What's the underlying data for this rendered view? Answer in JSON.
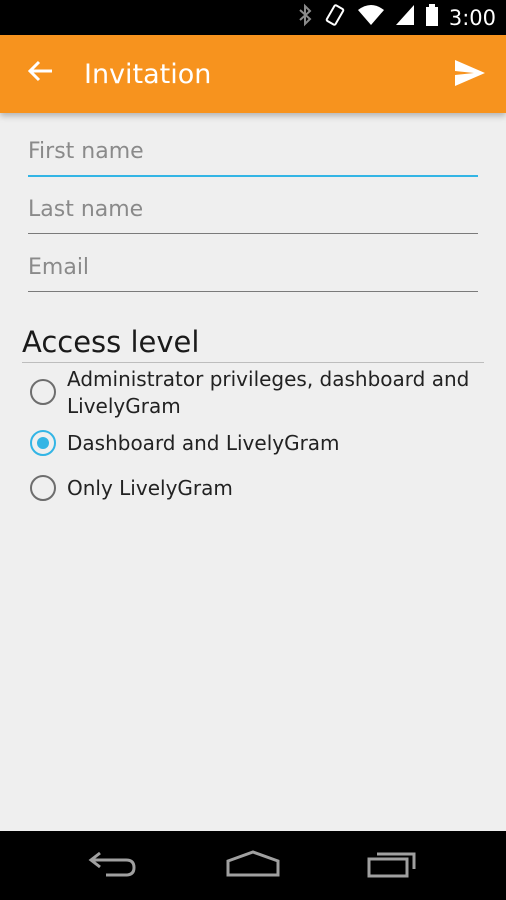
{
  "status_bar": {
    "time": "3:00"
  },
  "app_bar": {
    "title": "Invitation"
  },
  "form": {
    "first_name": {
      "placeholder": "First name",
      "value": ""
    },
    "last_name": {
      "placeholder": "Last name",
      "value": ""
    },
    "email": {
      "placeholder": "Email",
      "value": ""
    }
  },
  "access": {
    "title": "Access level",
    "options": [
      {
        "label": "Administrator privileges, dashboard and LivelyGram",
        "checked": false
      },
      {
        "label": "Dashboard and LivelyGram",
        "checked": true
      },
      {
        "label": "Only LivelyGram",
        "checked": false
      }
    ]
  },
  "colors": {
    "accent": "#33b5e5",
    "toolbar": "#f7931e"
  },
  "icons": {
    "status": [
      "bluetooth-icon",
      "vibrate-icon",
      "wifi-icon",
      "signal-icon",
      "battery-icon"
    ],
    "toolbar": [
      "back-arrow-icon",
      "send-icon"
    ],
    "nav": [
      "back-nav-icon",
      "home-nav-icon",
      "recents-nav-icon"
    ]
  }
}
